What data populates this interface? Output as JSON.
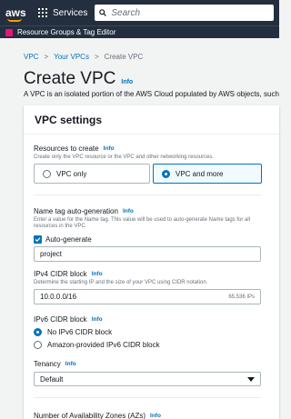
{
  "topnav": {
    "logo_text": "aws",
    "services_label": "Services",
    "search_placeholder": "Search"
  },
  "subnav": {
    "label": "Resource Groups & Tag Editor"
  },
  "breadcrumb": [
    "VPC",
    "Your VPCs",
    "Create VPC"
  ],
  "page": {
    "title": "Create VPC",
    "title_info": "Info",
    "description": "A VPC is an isolated portion of the AWS Cloud populated by AWS objects, such"
  },
  "vpc_settings": {
    "header": "VPC settings",
    "resources": {
      "label": "Resources to create",
      "info": "Info",
      "description": "Create only the VPC resource or the VPC and other networking resources.",
      "options": [
        "VPC only",
        "VPC and more"
      ],
      "selected": "VPC and more"
    },
    "name_tag": {
      "label": "Name tag auto-generation",
      "info": "Info",
      "description": "Enter a value for the Name tag. This value will be used to auto-generate Name tags for all resources in the VPC.",
      "auto_generate_label": "Auto-generate",
      "auto_generate_checked": true,
      "value": "project"
    },
    "ipv4": {
      "label": "IPv4 CIDR block",
      "info": "Info",
      "description": "Determine the starting IP and the size of your VPC using CIDR notation.",
      "value": "10.0.0.0/16",
      "suffix": "65,536 IPs"
    },
    "ipv6": {
      "label": "IPv6 CIDR block",
      "info": "Info",
      "options": [
        "No IPv6 CIDR block",
        "Amazon-provided IPv6 CIDR block"
      ],
      "selected": "No IPv6 CIDR block"
    },
    "tenancy": {
      "label": "Tenancy",
      "info": "Info",
      "value": "Default"
    },
    "azs": {
      "label": "Number of Availability Zones (AZs)",
      "info": "Info"
    }
  },
  "colors": {
    "nav_bg": "#232f3e",
    "accent": "#0073bb",
    "logo_smile": "#ff9900",
    "resource_groups_icon": "#e7157b"
  }
}
